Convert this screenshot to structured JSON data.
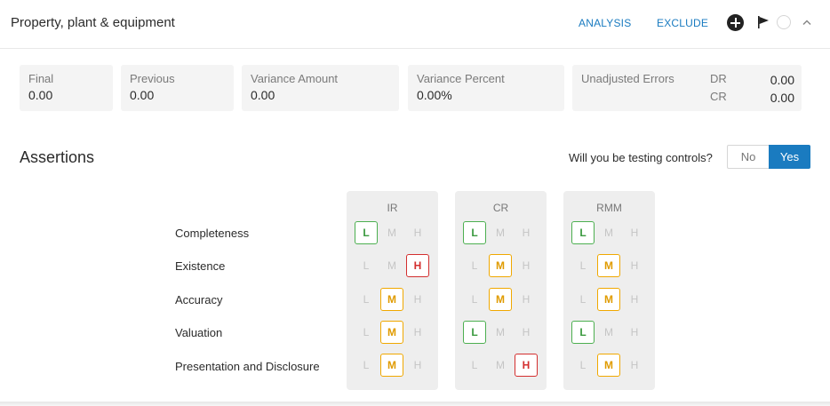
{
  "header": {
    "title": "Property, plant & equipment",
    "analysis_label": "ANALYSIS",
    "exclude_label": "EXCLUDE",
    "icons": [
      "plus-circle-icon",
      "flag-icon",
      "circle-icon",
      "chevron-up-icon"
    ]
  },
  "summary": [
    {
      "label": "Final",
      "value": "0.00"
    },
    {
      "label": "Previous",
      "value": "0.00"
    },
    {
      "label": "Variance Amount",
      "value": "0.00"
    },
    {
      "label": "Variance Percent",
      "value": "0.00%"
    }
  ],
  "unadjusted": {
    "label": "Unadjusted Errors",
    "dr_label": "DR",
    "dr_value": "0.00",
    "cr_label": "CR",
    "cr_value": "0.00"
  },
  "assertions": {
    "title": "Assertions",
    "testing_question": "Will you be testing controls?",
    "toggle_no": "No",
    "toggle_yes": "Yes",
    "toggle_selected": "Yes",
    "rows": [
      "Completeness",
      "Existence",
      "Accuracy",
      "Valuation",
      "Presentation and Disclosure"
    ],
    "level_letters": [
      "L",
      "M",
      "H"
    ],
    "panels": [
      {
        "title": "IR",
        "selected": [
          "L",
          "H",
          "M",
          "M",
          "M"
        ]
      },
      {
        "title": "CR",
        "selected": [
          "L",
          "M",
          "M",
          "L",
          "H"
        ]
      },
      {
        "title": "RMM",
        "selected": [
          "L",
          "M",
          "M",
          "L",
          "M"
        ]
      }
    ]
  },
  "colors": {
    "accent": "#1a7bc0",
    "low": "#4caf50",
    "medium": "#f0a800",
    "high": "#d32f2f"
  }
}
